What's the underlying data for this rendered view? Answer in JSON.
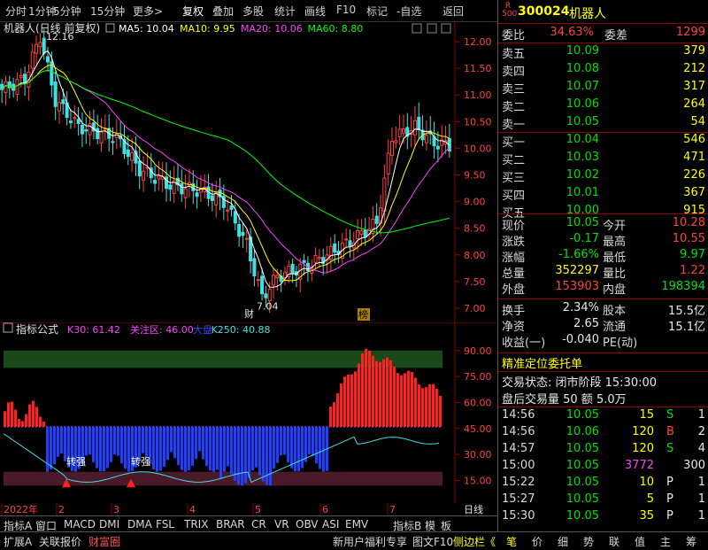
{
  "toolbar": {
    "items": [
      "分时",
      "1分钟",
      "5分钟",
      "15分钟",
      "更多>",
      "复权",
      "叠加",
      "多股",
      "统计",
      "画线",
      "F10",
      "标记",
      "-自选",
      "返回"
    ]
  },
  "main_chart": {
    "title": "机器人(日线 前复权)",
    "ma": [
      {
        "label": "MA5: 10.04",
        "color": "#ffffff"
      },
      {
        "label": "MA10: 9.95",
        "color": "#ffff00"
      },
      {
        "label": "MA20: 10.06",
        "color": "#ff40ff"
      },
      {
        "label": "MA60: 8.80",
        "color": "#00ff00"
      }
    ],
    "high_label": "12.16",
    "low_label": "7.04",
    "yticks": [
      "12.00",
      "11.50",
      "11.00",
      "10.50",
      "10.00",
      "9.50",
      "9.00",
      "8.50",
      "8.00",
      "7.50",
      "7.00"
    ],
    "marker_cai": "财",
    "marker_bang": "榜"
  },
  "indicator": {
    "title": "指标公式",
    "params": [
      {
        "label": "K30: 61.42",
        "color": "#ff40ff"
      },
      {
        "label": "关注区: 46.00",
        "color": "#ff40ff"
      },
      {
        "label": "大盘",
        "color": "#4040ff"
      },
      {
        "label": "K250: 40.88",
        "color": "#40e0e0"
      }
    ],
    "yticks": [
      "90.00",
      "75.00",
      "60.00",
      "45.00",
      "30.00",
      "15.00"
    ],
    "signal1": "转强",
    "signal2": "转强"
  },
  "dates": [
    "2022年",
    "2",
    "3",
    "4",
    "5",
    "6",
    "7",
    "日线"
  ],
  "tabs1": [
    "指标A",
    "窗口",
    "MACD",
    "DMI",
    "DMA",
    "FSL",
    "TRIX",
    "BRAR",
    "CR",
    "VR",
    "OBV",
    "ASI",
    "EMV",
    "",
    "指标B",
    "模",
    "板"
  ],
  "tabs2_left": [
    "扩展A",
    "关联报价",
    "财富圈"
  ],
  "tabs2_right": [
    "新用户福利专享",
    "图文F10",
    "侧边栏《"
  ],
  "tabs2_side": [
    "笔",
    "价",
    "细",
    "势",
    "联",
    "值",
    "主",
    "筹"
  ],
  "quote": {
    "code": "300024",
    "name": "机器人",
    "weibi_label": "委比",
    "weibi": "34.63%",
    "weicha_label": "委差",
    "weicha": "1299",
    "sell": [
      {
        "label": "卖五",
        "price": "10.09",
        "vol": "379"
      },
      {
        "label": "卖四",
        "price": "10.08",
        "vol": "212"
      },
      {
        "label": "卖三",
        "price": "10.07",
        "vol": "317"
      },
      {
        "label": "卖二",
        "price": "10.06",
        "vol": "264"
      },
      {
        "label": "卖一",
        "price": "10.05",
        "vol": "54"
      }
    ],
    "buy": [
      {
        "label": "买一",
        "price": "10.04",
        "vol": "546"
      },
      {
        "label": "买二",
        "price": "10.03",
        "vol": "471"
      },
      {
        "label": "买三",
        "price": "10.02",
        "vol": "226"
      },
      {
        "label": "买四",
        "price": "10.01",
        "vol": "367"
      },
      {
        "label": "买五",
        "price": "10.00",
        "vol": "915"
      }
    ],
    "stats": [
      {
        "l1": "现价",
        "v1": "10.05",
        "c1": "grn",
        "l2": "今开",
        "v2": "10.28",
        "c2": "red"
      },
      {
        "l1": "涨跌",
        "v1": "-0.17",
        "c1": "grn",
        "l2": "最高",
        "v2": "10.55",
        "c2": "red"
      },
      {
        "l1": "涨幅",
        "v1": "-1.66%",
        "c1": "grn",
        "l2": "最低",
        "v2": "9.97",
        "c2": "grn"
      },
      {
        "l1": "总量",
        "v1": "352297",
        "c1": "yel",
        "l2": "量比",
        "v2": "1.22",
        "c2": "red"
      },
      {
        "l1": "外盘",
        "v1": "153903",
        "c1": "red",
        "l2": "内盘",
        "v2": "198394",
        "c2": "grn"
      }
    ],
    "stats2": [
      {
        "l1": "换手",
        "v1": "2.34%",
        "l2": "股本",
        "v2": "15.5亿"
      },
      {
        "l1": "净资",
        "v1": "2.65",
        "l2": "流通",
        "v2": "15.1亿"
      },
      {
        "l1": "收益(一)",
        "v1": "-0.040",
        "l2": "PE(动)",
        "v2": ""
      }
    ],
    "order_title": "精准定位委托单",
    "trade_status": "交易状态: 闭市阶段 15:30:00",
    "after_trade": "盘后交易量 50 额 5.0万",
    "ticks": [
      {
        "t": "14:56",
        "p": "10.05",
        "v": "15",
        "s": "S",
        "n": "1",
        "vc": "yel",
        "sc": "grn"
      },
      {
        "t": "14:56",
        "p": "10.06",
        "v": "120",
        "s": "B",
        "n": "2",
        "vc": "yel",
        "sc": "red"
      },
      {
        "t": "14:57",
        "p": "10.05",
        "v": "120",
        "s": "S",
        "n": "4",
        "vc": "yel",
        "sc": "grn"
      },
      {
        "t": "15:00",
        "p": "10.05",
        "v": "3772",
        "s": "",
        "n": "300",
        "vc": "mag",
        "sc": "wht"
      },
      {
        "t": "15:22",
        "p": "10.05",
        "v": "10",
        "s": "P",
        "n": "1",
        "vc": "yel",
        "sc": "wht"
      },
      {
        "t": "15:27",
        "p": "10.05",
        "v": "5",
        "s": "P",
        "n": "1",
        "vc": "yel",
        "sc": "wht"
      },
      {
        "t": "15:30",
        "p": "10.05",
        "v": "35",
        "s": "P",
        "n": "1",
        "vc": "yel",
        "sc": "wht"
      }
    ]
  }
}
